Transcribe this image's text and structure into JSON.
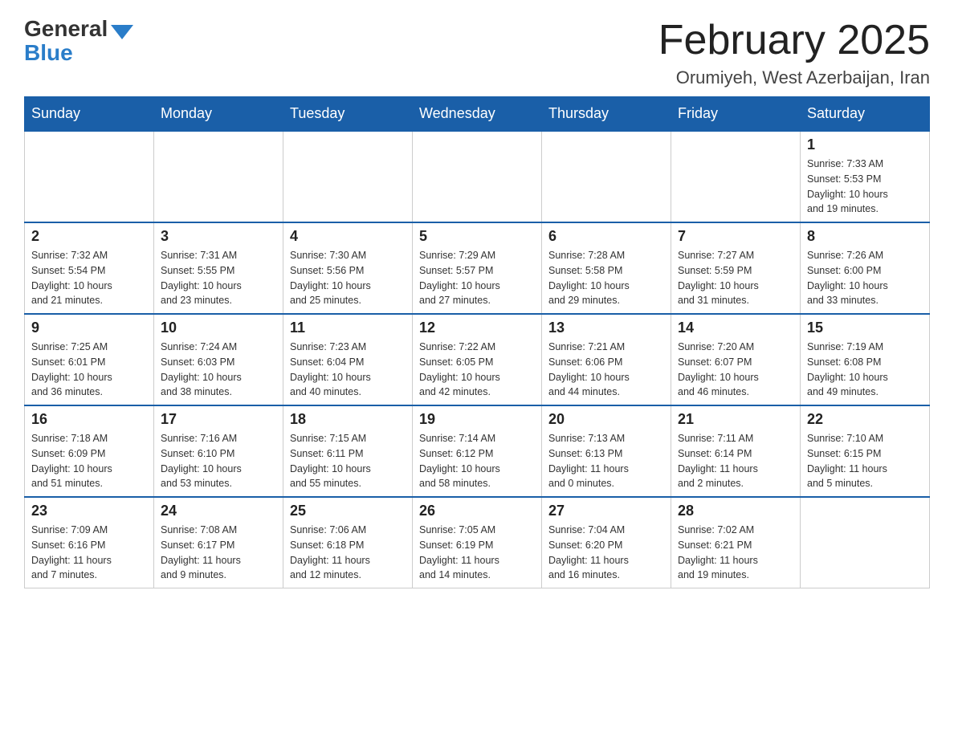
{
  "header": {
    "logo_general": "General",
    "logo_blue": "Blue",
    "title": "February 2025",
    "subtitle": "Orumiyeh, West Azerbaijan, Iran"
  },
  "days_of_week": [
    "Sunday",
    "Monday",
    "Tuesday",
    "Wednesday",
    "Thursday",
    "Friday",
    "Saturday"
  ],
  "weeks": [
    {
      "days": [
        {
          "number": "",
          "info": ""
        },
        {
          "number": "",
          "info": ""
        },
        {
          "number": "",
          "info": ""
        },
        {
          "number": "",
          "info": ""
        },
        {
          "number": "",
          "info": ""
        },
        {
          "number": "",
          "info": ""
        },
        {
          "number": "1",
          "info": "Sunrise: 7:33 AM\nSunset: 5:53 PM\nDaylight: 10 hours\nand 19 minutes."
        }
      ]
    },
    {
      "days": [
        {
          "number": "2",
          "info": "Sunrise: 7:32 AM\nSunset: 5:54 PM\nDaylight: 10 hours\nand 21 minutes."
        },
        {
          "number": "3",
          "info": "Sunrise: 7:31 AM\nSunset: 5:55 PM\nDaylight: 10 hours\nand 23 minutes."
        },
        {
          "number": "4",
          "info": "Sunrise: 7:30 AM\nSunset: 5:56 PM\nDaylight: 10 hours\nand 25 minutes."
        },
        {
          "number": "5",
          "info": "Sunrise: 7:29 AM\nSunset: 5:57 PM\nDaylight: 10 hours\nand 27 minutes."
        },
        {
          "number": "6",
          "info": "Sunrise: 7:28 AM\nSunset: 5:58 PM\nDaylight: 10 hours\nand 29 minutes."
        },
        {
          "number": "7",
          "info": "Sunrise: 7:27 AM\nSunset: 5:59 PM\nDaylight: 10 hours\nand 31 minutes."
        },
        {
          "number": "8",
          "info": "Sunrise: 7:26 AM\nSunset: 6:00 PM\nDaylight: 10 hours\nand 33 minutes."
        }
      ]
    },
    {
      "days": [
        {
          "number": "9",
          "info": "Sunrise: 7:25 AM\nSunset: 6:01 PM\nDaylight: 10 hours\nand 36 minutes."
        },
        {
          "number": "10",
          "info": "Sunrise: 7:24 AM\nSunset: 6:03 PM\nDaylight: 10 hours\nand 38 minutes."
        },
        {
          "number": "11",
          "info": "Sunrise: 7:23 AM\nSunset: 6:04 PM\nDaylight: 10 hours\nand 40 minutes."
        },
        {
          "number": "12",
          "info": "Sunrise: 7:22 AM\nSunset: 6:05 PM\nDaylight: 10 hours\nand 42 minutes."
        },
        {
          "number": "13",
          "info": "Sunrise: 7:21 AM\nSunset: 6:06 PM\nDaylight: 10 hours\nand 44 minutes."
        },
        {
          "number": "14",
          "info": "Sunrise: 7:20 AM\nSunset: 6:07 PM\nDaylight: 10 hours\nand 46 minutes."
        },
        {
          "number": "15",
          "info": "Sunrise: 7:19 AM\nSunset: 6:08 PM\nDaylight: 10 hours\nand 49 minutes."
        }
      ]
    },
    {
      "days": [
        {
          "number": "16",
          "info": "Sunrise: 7:18 AM\nSunset: 6:09 PM\nDaylight: 10 hours\nand 51 minutes."
        },
        {
          "number": "17",
          "info": "Sunrise: 7:16 AM\nSunset: 6:10 PM\nDaylight: 10 hours\nand 53 minutes."
        },
        {
          "number": "18",
          "info": "Sunrise: 7:15 AM\nSunset: 6:11 PM\nDaylight: 10 hours\nand 55 minutes."
        },
        {
          "number": "19",
          "info": "Sunrise: 7:14 AM\nSunset: 6:12 PM\nDaylight: 10 hours\nand 58 minutes."
        },
        {
          "number": "20",
          "info": "Sunrise: 7:13 AM\nSunset: 6:13 PM\nDaylight: 11 hours\nand 0 minutes."
        },
        {
          "number": "21",
          "info": "Sunrise: 7:11 AM\nSunset: 6:14 PM\nDaylight: 11 hours\nand 2 minutes."
        },
        {
          "number": "22",
          "info": "Sunrise: 7:10 AM\nSunset: 6:15 PM\nDaylight: 11 hours\nand 5 minutes."
        }
      ]
    },
    {
      "days": [
        {
          "number": "23",
          "info": "Sunrise: 7:09 AM\nSunset: 6:16 PM\nDaylight: 11 hours\nand 7 minutes."
        },
        {
          "number": "24",
          "info": "Sunrise: 7:08 AM\nSunset: 6:17 PM\nDaylight: 11 hours\nand 9 minutes."
        },
        {
          "number": "25",
          "info": "Sunrise: 7:06 AM\nSunset: 6:18 PM\nDaylight: 11 hours\nand 12 minutes."
        },
        {
          "number": "26",
          "info": "Sunrise: 7:05 AM\nSunset: 6:19 PM\nDaylight: 11 hours\nand 14 minutes."
        },
        {
          "number": "27",
          "info": "Sunrise: 7:04 AM\nSunset: 6:20 PM\nDaylight: 11 hours\nand 16 minutes."
        },
        {
          "number": "28",
          "info": "Sunrise: 7:02 AM\nSunset: 6:21 PM\nDaylight: 11 hours\nand 19 minutes."
        },
        {
          "number": "",
          "info": ""
        }
      ]
    }
  ]
}
